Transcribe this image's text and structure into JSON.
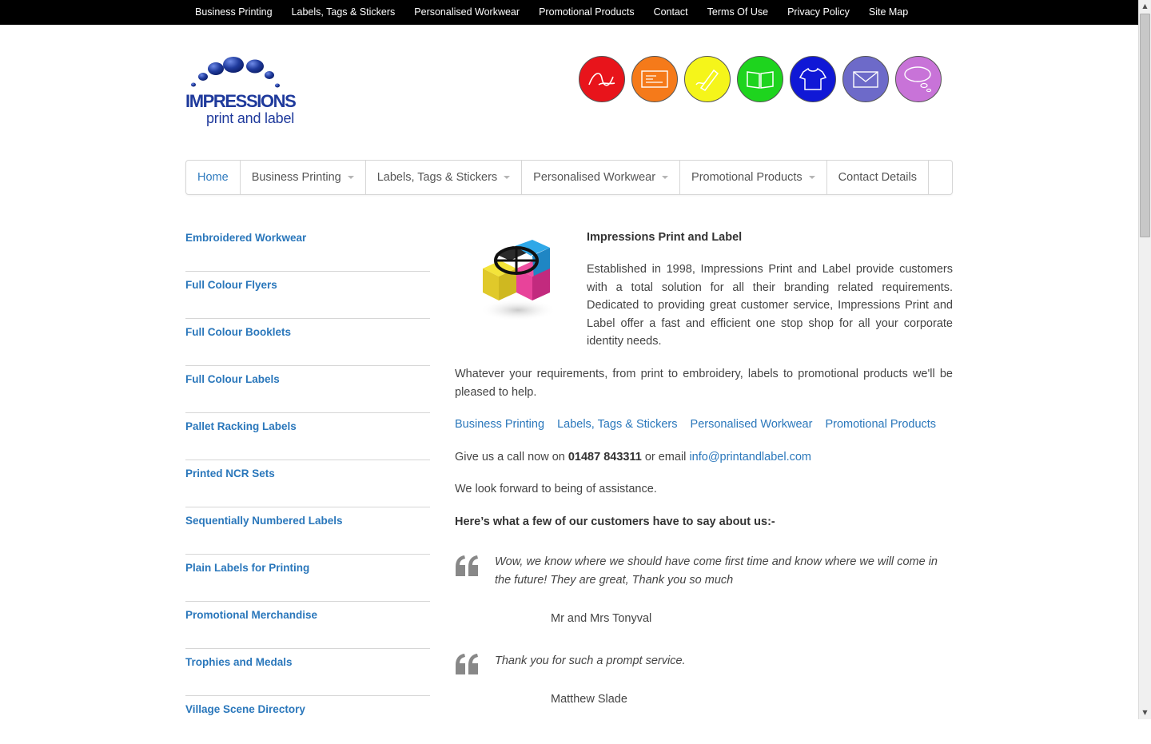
{
  "topbar": {
    "links": [
      "Business Printing",
      "Labels, Tags & Stickers",
      "Personalised Workwear",
      "Promotional Products",
      "Contact",
      "Terms Of Use",
      "Privacy Policy",
      "Site Map"
    ]
  },
  "logo": {
    "line1": "IMPRESSIONS",
    "line2": "print and label",
    "color": "#1f3a9c"
  },
  "icon_circles": [
    {
      "icon": "signature-icon",
      "color": "#e8141b"
    },
    {
      "icon": "business-card-icon",
      "color": "#f57a1a"
    },
    {
      "icon": "marker-pen-icon",
      "color": "#f5f51a"
    },
    {
      "icon": "open-book-icon",
      "color": "#1ed41e"
    },
    {
      "icon": "tshirt-icon",
      "color": "#1018d6"
    },
    {
      "icon": "envelope-icon",
      "color": "#6d6ac9"
    },
    {
      "icon": "speech-bubble-icon",
      "color": "#c873d8"
    }
  ],
  "nav": {
    "items": [
      "Home",
      "Business Printing",
      "Labels, Tags & Stickers",
      "Personalised Workwear",
      "Promotional Products",
      "Contact Details"
    ],
    "active": "Home"
  },
  "sidebar": {
    "items": [
      "Embroidered Workwear",
      "Full Colour Flyers",
      "Full Colour Booklets",
      "Full Colour Labels",
      "Pallet Racking Labels",
      "Printed NCR Sets",
      "Sequentially Numbered Labels",
      "Plain Labels for Printing",
      "Promotional Merchandise",
      "Trophies and Medals",
      "Village Scene Directory"
    ]
  },
  "main": {
    "heading": "Impressions Print and Label",
    "intro": "Established in 1998, Impressions Print and Label provide customers with a total solution for all their branding related requirements. Dedicated to providing great customer service, Impressions Print and Label offer a fast and efficient one stop shop for all your corporate identity needs.",
    "requirements": "Whatever your requirements, from print to embroidery, labels to promotional products we'll be pleased to help.",
    "links": [
      "Business Printing",
      "Labels, Tags & Stickers",
      "Personalised Workwear",
      "Promotional Products"
    ],
    "call_prefix": "Give us a call now on ",
    "phone": "01487 843311",
    "call_mid": " or email ",
    "email": "info@printandlabel.com",
    "look_forward": "We look forward to being of assistance.",
    "testimonials_heading": "Here’s what a few of our customers have to say about us:-",
    "testimonials": [
      {
        "text": "Wow, we know where we should have come first time and know where we will come in the future! They are great, Thank you so much",
        "author": "Mr and Mrs Tonyval"
      },
      {
        "text": "Thank you for such a prompt service.",
        "author": "Matthew Slade"
      }
    ]
  },
  "colors": {
    "link": "#2a77bb",
    "topbar_bg": "#000000",
    "border": "#d6d6d6"
  }
}
